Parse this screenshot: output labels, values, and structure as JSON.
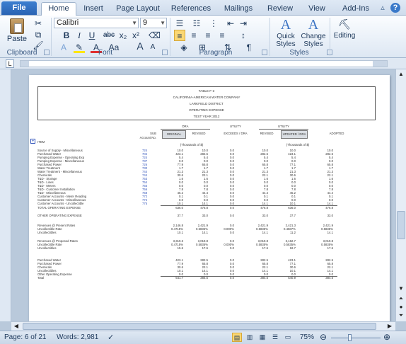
{
  "ribbon_tabs": [
    "File",
    "Home",
    "Insert",
    "Page Layout",
    "References",
    "Mailings",
    "Review",
    "View",
    "Add-Ins"
  ],
  "active_tab": "Home",
  "clipboard": {
    "paste_label": "Paste",
    "group_label": "Clipboard"
  },
  "font": {
    "name": "Calibri",
    "size": "9",
    "group_label": "Font",
    "bold": "B",
    "italic": "I",
    "underline": "U",
    "strike": "abc",
    "sub": "x₂",
    "sup": "x²",
    "aa": "Aa",
    "grow": "A",
    "shrink": "A"
  },
  "paragraph": {
    "group_label": "Paragraph"
  },
  "styles": {
    "quick_label": "Quick Styles",
    "change_label": "Change Styles",
    "group_label": "Styles"
  },
  "editing": {
    "label": "Editing"
  },
  "status": {
    "page": "Page: 6 of 21",
    "words": "Words: 2,981",
    "zoom": "75%",
    "zoom_fraction": 0.75
  },
  "doc": {
    "title_lines": [
      "TABLE F-3",
      "CALIFORNIA-AMERICAN WATER COMPANY",
      "LARKFIELD DISTRICT",
      "OPERATING EXPENSE",
      "TEST YEAR 2012"
    ],
    "col_groups": [
      "DRA",
      "UTILITY",
      "UTILITY"
    ],
    "col_headers": [
      "ORIGINAL",
      "REVISED",
      "EXCEEDS / DRA",
      "REVISED",
      "UPDATED / DRA",
      "ADOPTED"
    ],
    "sub_headers": [
      "SUB",
      "Account No."
    ],
    "item_label": "ITEM",
    "units": [
      "(Thousands of $)",
      "(Thousands of $)"
    ],
    "rows": [
      {
        "item": "Source of Supply - Miscellaneous",
        "acct": "724",
        "vals": [
          "10.0",
          "10.0",
          "0.0",
          "10.0",
          "10.0",
          "10.0"
        ]
      },
      {
        "item": "Purchased Water",
        "acct": "704",
        "vals": [
          "423.1",
          "282.5",
          "0.0",
          "282.5",
          "423.1",
          "282.5"
        ]
      },
      {
        "item": "Pumping Expense - Operating Exp",
        "acct": "724",
        "vals": [
          "5.4",
          "5.4",
          "0.0",
          "5.4",
          "5.4",
          "5.4"
        ]
      },
      {
        "item": "Pumping Expense - Miscellaneous",
        "acct": "737",
        "vals": [
          "0.0",
          "0.0",
          "0.0",
          "0.0",
          "0.0",
          "0.0"
        ]
      },
      {
        "item": "Purchased Power",
        "acct": "726",
        "vals": [
          "77.9",
          "65.8",
          "0.0",
          "65.8",
          "77.1",
          "65.8"
        ]
      },
      {
        "item": "Water Treatment",
        "acct": "730",
        "vals": [
          "1.7",
          "1.7",
          "0.0",
          "1.7",
          "1.7",
          "1.7"
        ]
      },
      {
        "item": "Water Treatment - Miscellaneous",
        "acct": "744",
        "vals": [
          "21.3",
          "21.3",
          "0.0",
          "21.3",
          "21.3",
          "21.3"
        ]
      },
      {
        "item": "Chemicals",
        "acct": "744",
        "vals": [
          "30.6",
          "22.1",
          "0.0",
          "22.1",
          "30.6",
          "22.1"
        ]
      },
      {
        "item": "T&D - Storage",
        "acct": "753",
        "vals": [
          "1.6",
          "1.6",
          "0.0",
          "1.6",
          "1.6",
          "1.6"
        ]
      },
      {
        "item": "T&D - Lines",
        "acct": "754",
        "vals": [
          "0.0",
          "0.0",
          "0.0",
          "0.0",
          "0.0",
          "0.0"
        ]
      },
      {
        "item": "T&D - Meters",
        "acct": "755",
        "vals": [
          "0.0",
          "0.0",
          "0.0",
          "0.0",
          "0.0",
          "0.0"
        ]
      },
      {
        "item": "T&D - Customer Installation",
        "acct": "756",
        "vals": [
          "7.8",
          "7.8",
          "0.0",
          "7.8",
          "7.8",
          "7.8"
        ]
      },
      {
        "item": "T&D - Miscellaneous",
        "acct": "758",
        "vals": [
          "45.2",
          "44.4",
          "0.0",
          "44.4",
          "45.2",
          "44.4"
        ]
      },
      {
        "item": "Customer Accounts - Meter Reading",
        "acct": "772",
        "vals": [
          "0.1",
          "0.1",
          "0.0",
          "0.1",
          "0.1",
          "0.1"
        ]
      },
      {
        "item": "Customer Accounts - Miscellaneous",
        "acct": "774",
        "vals": [
          "0.0",
          "0.0",
          "0.0",
          "0.0",
          "0.0",
          "0.0"
        ]
      },
      {
        "item": "Customer Accounts - Uncollectible",
        "acct": "775",
        "vals": [
          "10.1",
          "14.1",
          "0.0",
          "14.1",
          "10.1",
          "14.1"
        ]
      }
    ],
    "total_label": "TOTAL OPERATING EXPENSE",
    "total_vals": [
      "636.0",
      "476.8",
      "0.0",
      "476.8",
      "636.0",
      "476.8"
    ],
    "other_label": "OTHER OPERATING EXPENSE",
    "other_vals": [
      "37.7",
      "33.0",
      "0.0",
      "33.0",
      "37.7",
      "33.0"
    ],
    "block2": [
      {
        "item": "Revenues @ Present Rates",
        "vals": [
          "2,146.8",
          "2,421.9",
          "0.0",
          "2,421.9",
          "2,421.3",
          "2,421.9"
        ]
      },
      {
        "item": "Uncollectible Rate",
        "vals": [
          "0.4715%",
          "0.5835%",
          "0.000%",
          "0.5835%",
          "0.4587%",
          "0.5835%"
        ]
      },
      {
        "item": "Uncollectibles",
        "vals": [
          "10.1",
          "14.1",
          "0.0",
          "14.1",
          "11.2",
          "14.1"
        ]
      }
    ],
    "block3": [
      {
        "item": "Revenues @ Proposed Rates",
        "vals": [
          "3,319.3",
          "3,019.8",
          "0.0",
          "3,019.8",
          "3,162.7",
          "3,019.8"
        ]
      },
      {
        "item": "Uncollectible Rate",
        "vals": [
          "0.4715%",
          "0.5835%",
          "0.000%",
          "0.5835%",
          "0.5835%",
          "0.5835%"
        ]
      },
      {
        "item": "Uncollectibles",
        "vals": [
          "15.6",
          "17.6",
          "0.0",
          "17.6",
          "18.7",
          "17.6"
        ]
      }
    ],
    "block4": [
      {
        "item": "Purchased Water",
        "vals": [
          "423.1",
          "282.5",
          "0.0",
          "282.5",
          "423.1",
          "282.5"
        ]
      },
      {
        "item": "Purchased Power",
        "vals": [
          "77.9",
          "65.8",
          "0.0",
          "65.8",
          "77.1",
          "65.8"
        ]
      },
      {
        "item": "Chemicals",
        "vals": [
          "30.6",
          "22.1",
          "0.0",
          "22.1",
          "30.6",
          "22.1"
        ]
      },
      {
        "item": "Uncollectibles",
        "vals": [
          "10.1",
          "14.1",
          "0.0",
          "14.1",
          "10.1",
          "14.1"
        ]
      },
      {
        "item": "Other Operating Expense",
        "vals": [
          "0.0",
          "0.0",
          "0.0",
          "0.0",
          "0.0",
          "0.0"
        ]
      },
      {
        "item": "Total",
        "vals": [
          "541.7",
          "384.5",
          "0.0",
          "384.5",
          "540.9",
          "384.5"
        ]
      }
    ]
  }
}
